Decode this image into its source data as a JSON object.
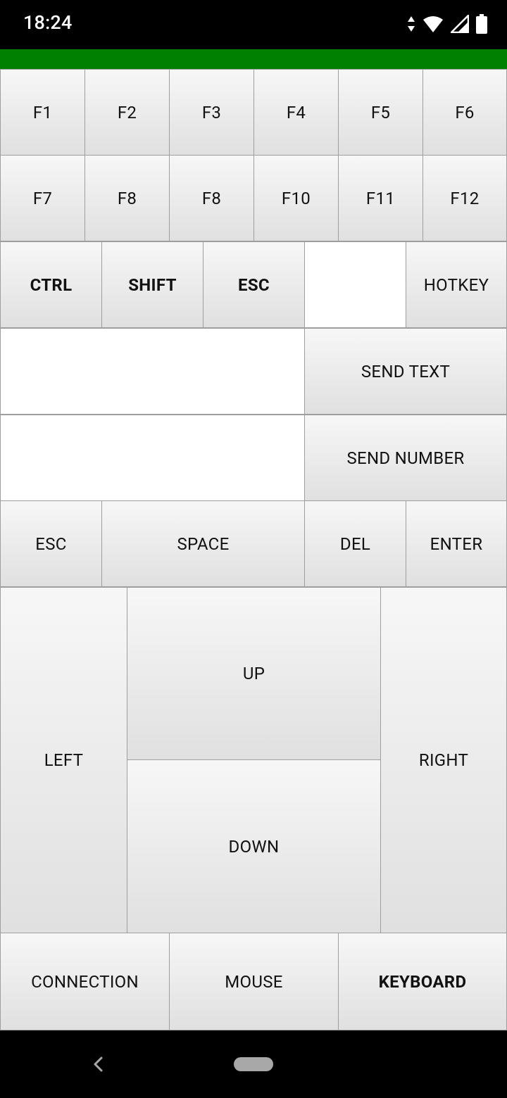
{
  "status_bar": {
    "time": "18:24",
    "icons": [
      "data-arrows-icon",
      "wifi-icon",
      "cell-signal-icon",
      "battery-icon"
    ],
    "wifi_badge": "4"
  },
  "colors": {
    "app_bar": "#008000",
    "key_top": "#f7f7f7",
    "key_bottom": "#e0e0e0",
    "border": "#9e9e9e"
  },
  "function_keys": [
    "F1",
    "F2",
    "F3",
    "F4",
    "F5",
    "F6",
    "F7",
    "F8",
    "F8",
    "F10",
    "F11",
    "F12"
  ],
  "modifiers": {
    "ctrl": "CTRL",
    "shift": "SHIFT",
    "esc": "ESC",
    "hotkey_input_value": "",
    "hotkey": "HOTKEY"
  },
  "send": {
    "text_input_value": "",
    "text_button": "SEND TEXT",
    "number_input_value": "",
    "number_button": "SEND NUMBER"
  },
  "special_keys": {
    "esc": "ESC",
    "space": "SPACE",
    "del": "DEL",
    "enter": "ENTER"
  },
  "arrows": {
    "left": "LEFT",
    "up": "UP",
    "down": "DOWN",
    "right": "RIGHT"
  },
  "bottom_tabs": {
    "connection": "CONNECTION",
    "mouse": "MOUSE",
    "keyboard": "KEYBOARD",
    "active": "keyboard"
  },
  "nav_bar": {
    "icons": [
      "back-icon",
      "home-pill-icon"
    ]
  }
}
